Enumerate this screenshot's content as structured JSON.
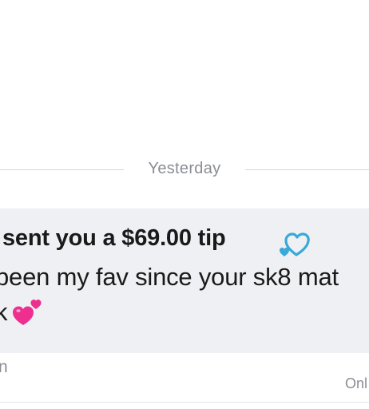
{
  "date_divider": {
    "label": "Yesterday"
  },
  "message": {
    "tip_text": "sent you a $69.00 tip",
    "body_line_1": "been my fav since your sk8 mat",
    "body_line_2": "k",
    "tip_emoji": "blue-heart-icon",
    "body_emoji": "two-hearts-icon",
    "time_partial": "n",
    "status_partial": "Onl"
  },
  "colors": {
    "card_background": "#eef0f3",
    "muted_text": "#8a8d93",
    "blue_heart": "#3aa8d8",
    "pink_heart": "#ee2f8f"
  }
}
